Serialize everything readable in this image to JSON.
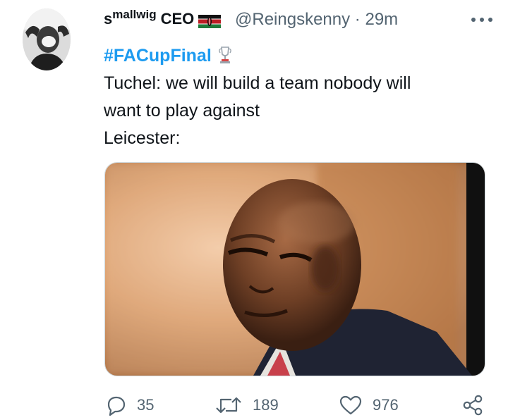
{
  "tweet": {
    "display_name": "smallwig CEO",
    "name_parts": {
      "first": "s",
      "superscript": "mallwig",
      "suffix": "CEO"
    },
    "flag_icon": "kenya-flag-icon",
    "handle": "@Reingskenny",
    "separator": "·",
    "time": "29m",
    "hashtag": "#FACupFinal",
    "line1": "Tuchel: we will build a team nobody will",
    "line2": "want to play against",
    "line3": "Leicester:"
  },
  "actions": {
    "reply_count": "35",
    "retweet_count": "189",
    "like_count": "976"
  },
  "colors": {
    "accent": "#1d9bf0",
    "muted": "#536471",
    "text": "#0f1419"
  }
}
